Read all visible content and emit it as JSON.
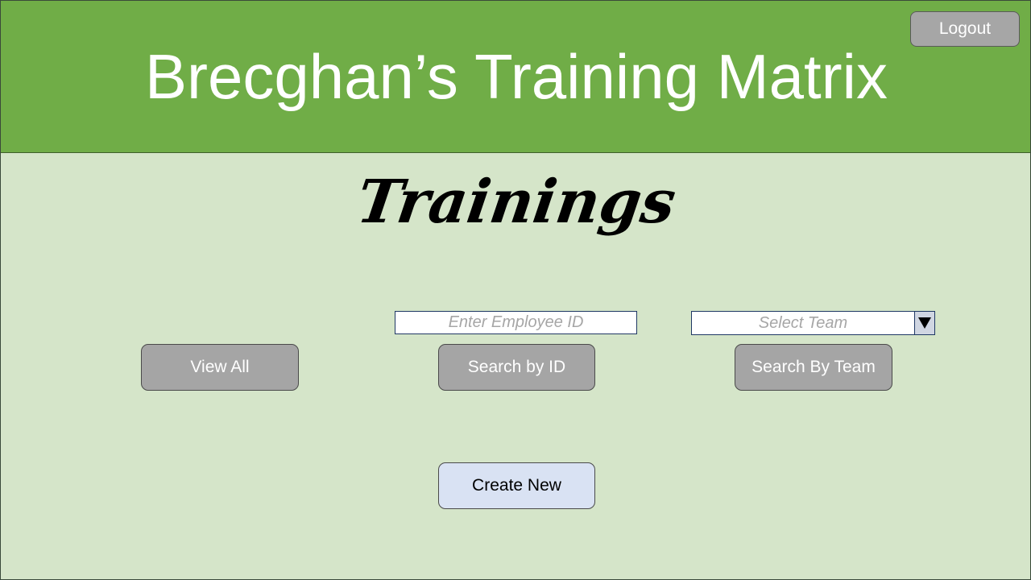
{
  "header": {
    "title": "Brecghan’s Training Matrix",
    "logout_label": "Logout"
  },
  "page": {
    "title": "Trainings"
  },
  "employee_search": {
    "placeholder": "Enter Employee ID",
    "value": ""
  },
  "team_select": {
    "selected": "Select Team",
    "arrow_icon": "triangle-down-icon"
  },
  "buttons": {
    "view_all": "View All",
    "search_by_id": "Search by ID",
    "search_by_team": "Search By Team",
    "create_new": "Create New"
  },
  "colors": {
    "header": "#70ad47",
    "background": "#d5e5c9",
    "button": "#a5a5a5",
    "create_button": "#d9e2f3"
  }
}
